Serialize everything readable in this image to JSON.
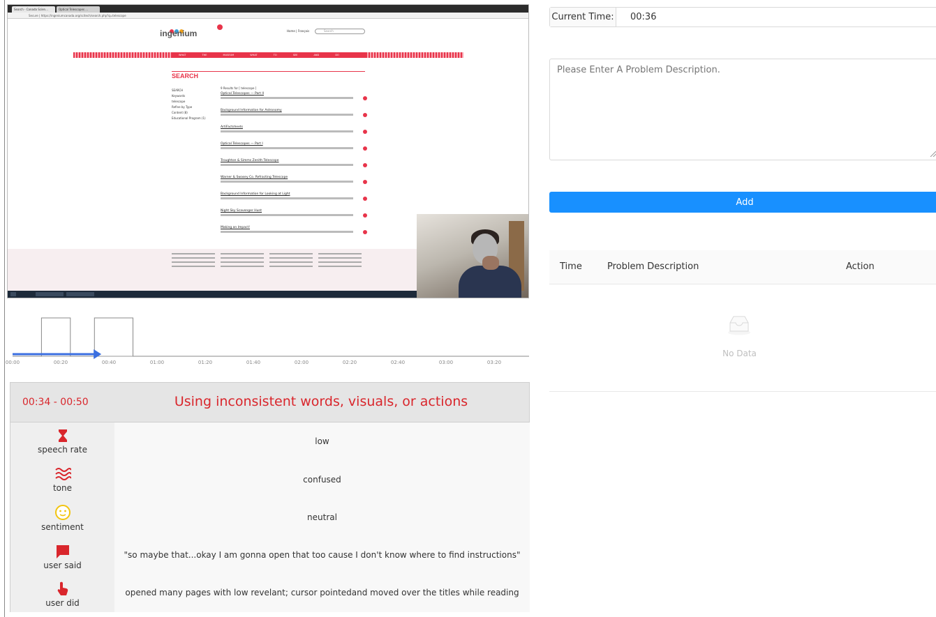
{
  "video": {
    "site_header_text": "Home | Français",
    "site_search_placeholder": "Search",
    "logo_text": "ingenium",
    "search_heading": "SEARCH",
    "results_heading": "9 Results for [ telescope ]",
    "sidebar_terms": [
      "SEARCH",
      "Keywords",
      "telescope",
      "Refine by Type",
      "Content (8)",
      "Educational Program (1)"
    ],
    "nav_items": [
      "WHAT THE MUSEUM",
      "WHAT TO SEE AND DO",
      "COLLECTION AND RESEARCH",
      "EDUCATIONAL PROGRAMS",
      "THE CHANNEL"
    ],
    "results": [
      "Optical Telescopes — Part II",
      "Background Information for Astronomy",
      "ArtiFactsheets",
      "Optical Telescopes — Part I",
      "Troughton & Simms Zenith Telescope",
      "Warner & Swasey Co. Refracting Telescope",
      "Background Information for Looking at Light",
      "Night Sky Scavenger Hunt",
      "Making an Impact!"
    ]
  },
  "timeline": {
    "ticks": [
      "00:00",
      "00:20",
      "00:40",
      "01:00",
      "01:20",
      "01:40",
      "02:00",
      "02:20",
      "02:40",
      "03:00",
      "03:20"
    ],
    "total_seconds": 220,
    "current_seconds": 36,
    "segments": [
      [
        12,
        24
      ],
      [
        34,
        50
      ]
    ]
  },
  "analysis": {
    "range": "00:34 - 00:50",
    "title": "Using inconsistent words, visuals, or actions",
    "metrics": [
      {
        "icon": "hourglass-icon",
        "label": "speech rate",
        "value": "low"
      },
      {
        "icon": "waves-icon",
        "label": "tone",
        "value": "confused"
      },
      {
        "icon": "smiley-icon",
        "label": "sentiment",
        "value": "neutral"
      },
      {
        "icon": "speech-bubble-icon",
        "label": "user said",
        "value": "\"so maybe that...okay I am gonna open that too cause I don't know where to find instructions\""
      },
      {
        "icon": "pointer-hand-icon",
        "label": "user did",
        "value": "opened many pages with low revelant; cursor pointedand moved over the titles while reading"
      }
    ]
  },
  "form": {
    "time_label": "Current Time:",
    "time_value": "00:36",
    "problem_placeholder": "Please Enter A Problem Description.",
    "add_label": "Add"
  },
  "table": {
    "columns": [
      "Time",
      "Problem Description",
      "Action"
    ],
    "empty_text": "No Data"
  },
  "colors": {
    "accent_red": "#d9262c",
    "primary_blue": "#1890ff",
    "sentiment_yellow": "#f2c40f"
  }
}
